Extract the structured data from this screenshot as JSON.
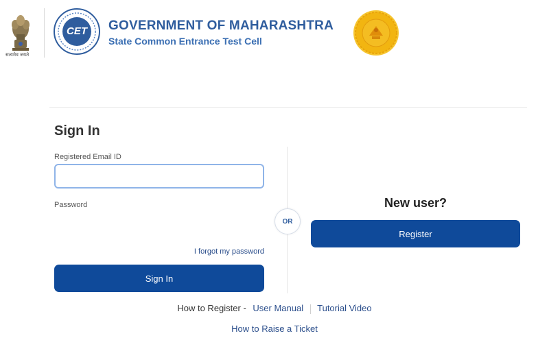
{
  "header": {
    "title": "GOVERNMENT OF MAHARASHTRA",
    "subtitle": "State Common Entrance Test Cell",
    "cet_logo_text": "CET",
    "emblem_caption": "सत्यमेव जयते"
  },
  "colors": {
    "primary": "#0f4a9a",
    "header_title": "#2f5d9e",
    "link": "#2c4f8c",
    "input_focus_border": "#8fb4e8",
    "seal_gold": "#f2b511"
  },
  "signin": {
    "title": "Sign In",
    "email_label": "Registered Email ID",
    "email_value": "",
    "email_placeholder": "",
    "password_label": "Password",
    "password_value": "",
    "forgot_link": "I forgot my password",
    "button": "Sign In"
  },
  "divider": {
    "or_label": "OR"
  },
  "new_user": {
    "heading": "New user?",
    "register_button": "Register"
  },
  "footer": {
    "how_to_register": "How to Register -",
    "user_manual": "User Manual",
    "tutorial_video": "Tutorial Video",
    "raise_ticket": "How to Raise a Ticket"
  },
  "icons": {
    "emblem": "national-emblem-icon",
    "cet_logo": "cet-logo-icon",
    "seal": "maharashtra-seal-icon"
  }
}
